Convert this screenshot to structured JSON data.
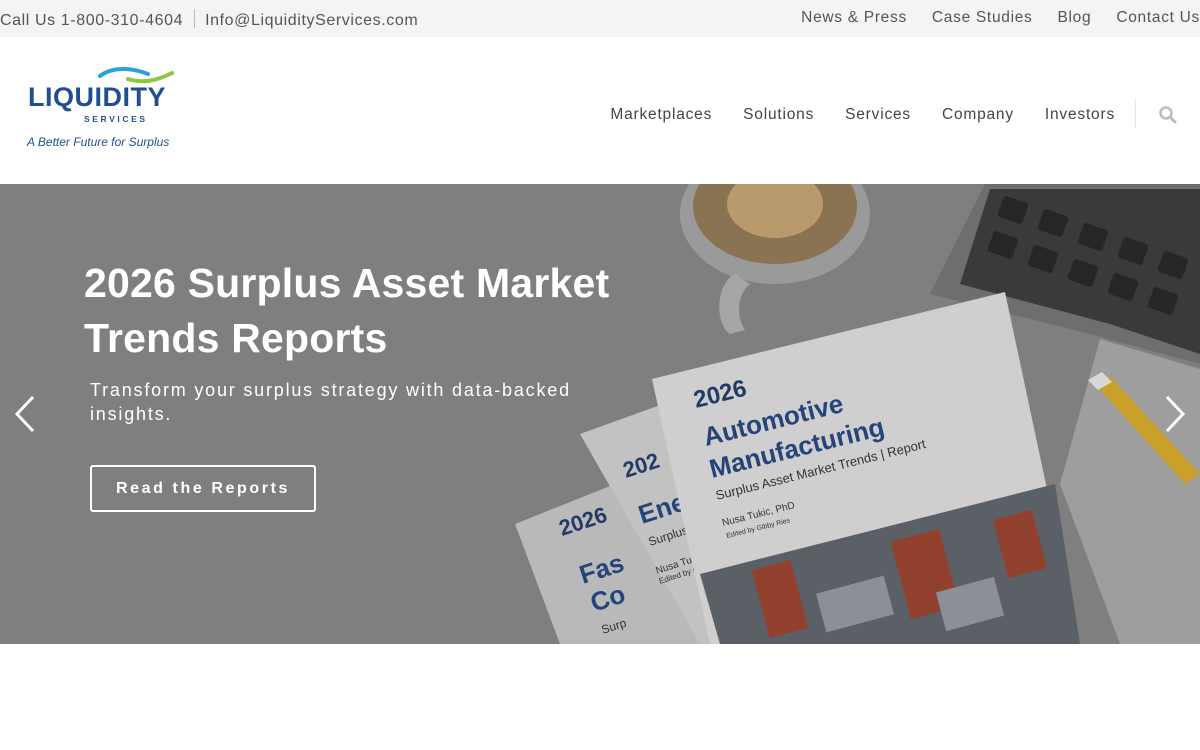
{
  "topbar": {
    "phone": "Call Us 1-800-310-4604",
    "email": "Info@LiquidityServices.com",
    "links": [
      "News & Press",
      "Case Studies",
      "Blog",
      "Contact Us"
    ]
  },
  "logo": {
    "brand": "LIQUIDITY",
    "sub": "SERVICES",
    "tagline": "A Better Future for Surplus"
  },
  "nav": {
    "items": [
      "Marketplaces",
      "Solutions",
      "Services",
      "Company",
      "Investors"
    ],
    "search_icon": "search-icon"
  },
  "hero": {
    "title": "2026 Surplus Asset Market Trends Reports",
    "subtitle": "Transform your surplus strategy with data-backed insights.",
    "cta": "Read the Reports",
    "prev_icon": "chevron-left-icon",
    "next_icon": "chevron-right-icon",
    "report_year": "2026",
    "report_title_main": "Automotive Manufacturing",
    "report_subtitle": "Surplus Asset Market Trends | Report",
    "report_author": "Nusa Tukic, PhD",
    "report_editor": "Edited by Gibby Ries",
    "report2_title": "Ene",
    "report2_sub": "Surplus",
    "report2_author": "Nusa Tu",
    "report2_editor": "Edited by G",
    "report2_year": "202",
    "report3_year": "2026",
    "report3_title_a": "Fas",
    "report3_title_b": "Co",
    "report3_sub": "Surp"
  },
  "colors": {
    "brand_blue": "#1f4f8f",
    "logo_blue_swoosh": "#2aa3dc",
    "logo_green_swoosh": "#8dc63f",
    "topbar_bg": "#f4f4f4",
    "hero_bg": "#7e7e7e"
  }
}
